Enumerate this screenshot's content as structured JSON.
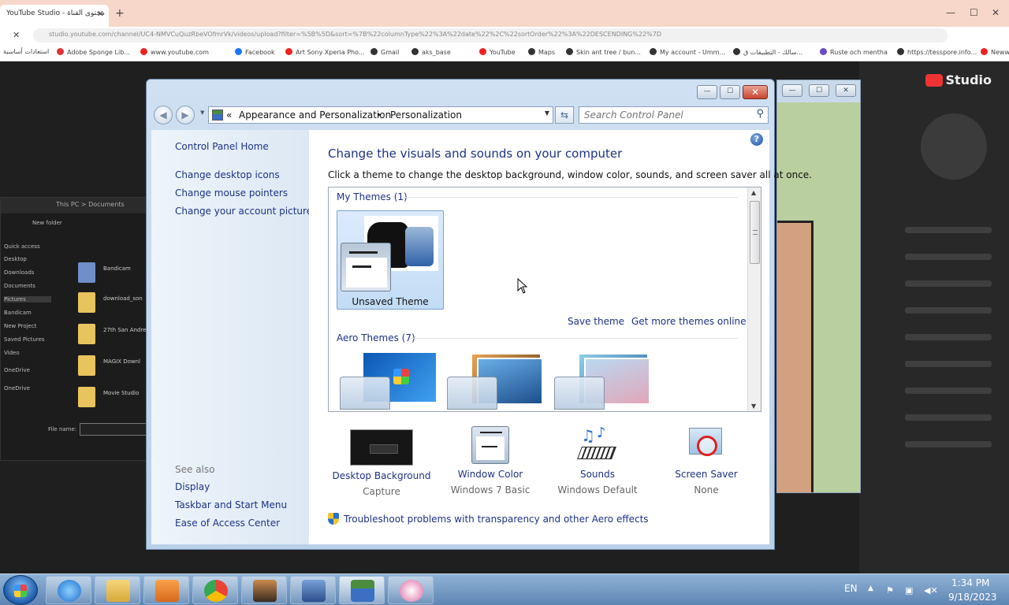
{
  "browser": {
    "tab_title": "YouTube Studio - محتوى القناة",
    "tab_close": "✕",
    "new_tab": "+",
    "win_min": "—",
    "win_max": "☐",
    "win_close": "✕",
    "url": "studio.youtube.com/channel/UC4-NMVCuQuzRbeVOfmrVk/videos/upload?filter=%5B%5D&sort=%7B%22columnType%22%3A%22date%22%2C%22sortOrder%22%3A%22DESCENDING%22%7D",
    "bookmarks": [
      "استعادات أساسية",
      "Adobe Sponge Lib...",
      "www.youtube.com",
      "Facebook",
      "Art Sony Xperia Pho...",
      "Gmail",
      "aks_base",
      "YouTube",
      "Maps",
      "Skin ant tree / bun...",
      "My account - Umm...",
      "سالك - التطبيقات ق...",
      "Ruste och mentha",
      "https://tesspore.info...",
      "Neww..."
    ]
  },
  "youtube": {
    "logo": "Studio"
  },
  "explorer": {
    "path": "This PC > Documents",
    "new_folder": "New folder",
    "nav": [
      "Quick access",
      "Desktop",
      "Downloads",
      "Documents",
      "Pictures",
      "Bandicam",
      "New Project",
      "Saved Pictures",
      "Video",
      "OneDrive",
      "OneDrive"
    ],
    "files": [
      "Bandicam",
      "download_son",
      "27th San Andre",
      "MAGIX Downl",
      "Movie Studio"
    ],
    "file_name_label": "File name:"
  },
  "cp": {
    "close": "✕",
    "max": "☐",
    "min": "—",
    "back": "◀",
    "fwd": "▶",
    "nav_drop": "▼",
    "crumb_prefix": "«",
    "crumb_1": "Appearance and Personalization",
    "crumb_sep": "▸",
    "crumb_2": "Personalization",
    "addr_drop": "▼",
    "refresh": "⇆",
    "search_placeholder": "Search Control Panel",
    "search_icon": "⚲",
    "left": {
      "home": "Control Panel Home",
      "link1": "Change desktop icons",
      "link2": "Change mouse pointers",
      "link3": "Change your account picture",
      "see_also": "See also",
      "display": "Display",
      "taskbar": "Taskbar and Start Menu",
      "ease": "Ease of Access Center"
    },
    "help": "?",
    "title": "Change the visuals and sounds on your computer",
    "subtitle": "Click a theme to change the desktop background, window color, sounds, and screen saver all at once.",
    "my_themes": "My Themes (1)",
    "unsaved_theme": "Unsaved Theme",
    "save_theme": "Save theme",
    "more_themes": "Get more themes online",
    "aero_themes": "Aero Themes (7)",
    "scroll_up": "▲",
    "scroll_down": "▼",
    "bottom": [
      {
        "label": "Desktop Background",
        "value": "Capture"
      },
      {
        "label": "Window Color",
        "value": "Windows 7 Basic"
      },
      {
        "label": "Sounds",
        "value": "Windows Default"
      },
      {
        "label": "Screen Saver",
        "value": "None"
      }
    ],
    "trouble_link": "Troubleshoot problems with transparency and other Aero effects"
  },
  "taskbar": {
    "lang": "EN",
    "tray_arrow": "▲",
    "time": "1:34 PM",
    "date": "9/18/2023"
  },
  "colors": {
    "link": "#1e3287",
    "accent": "#3a78c3",
    "close_red": "#c8452e"
  }
}
